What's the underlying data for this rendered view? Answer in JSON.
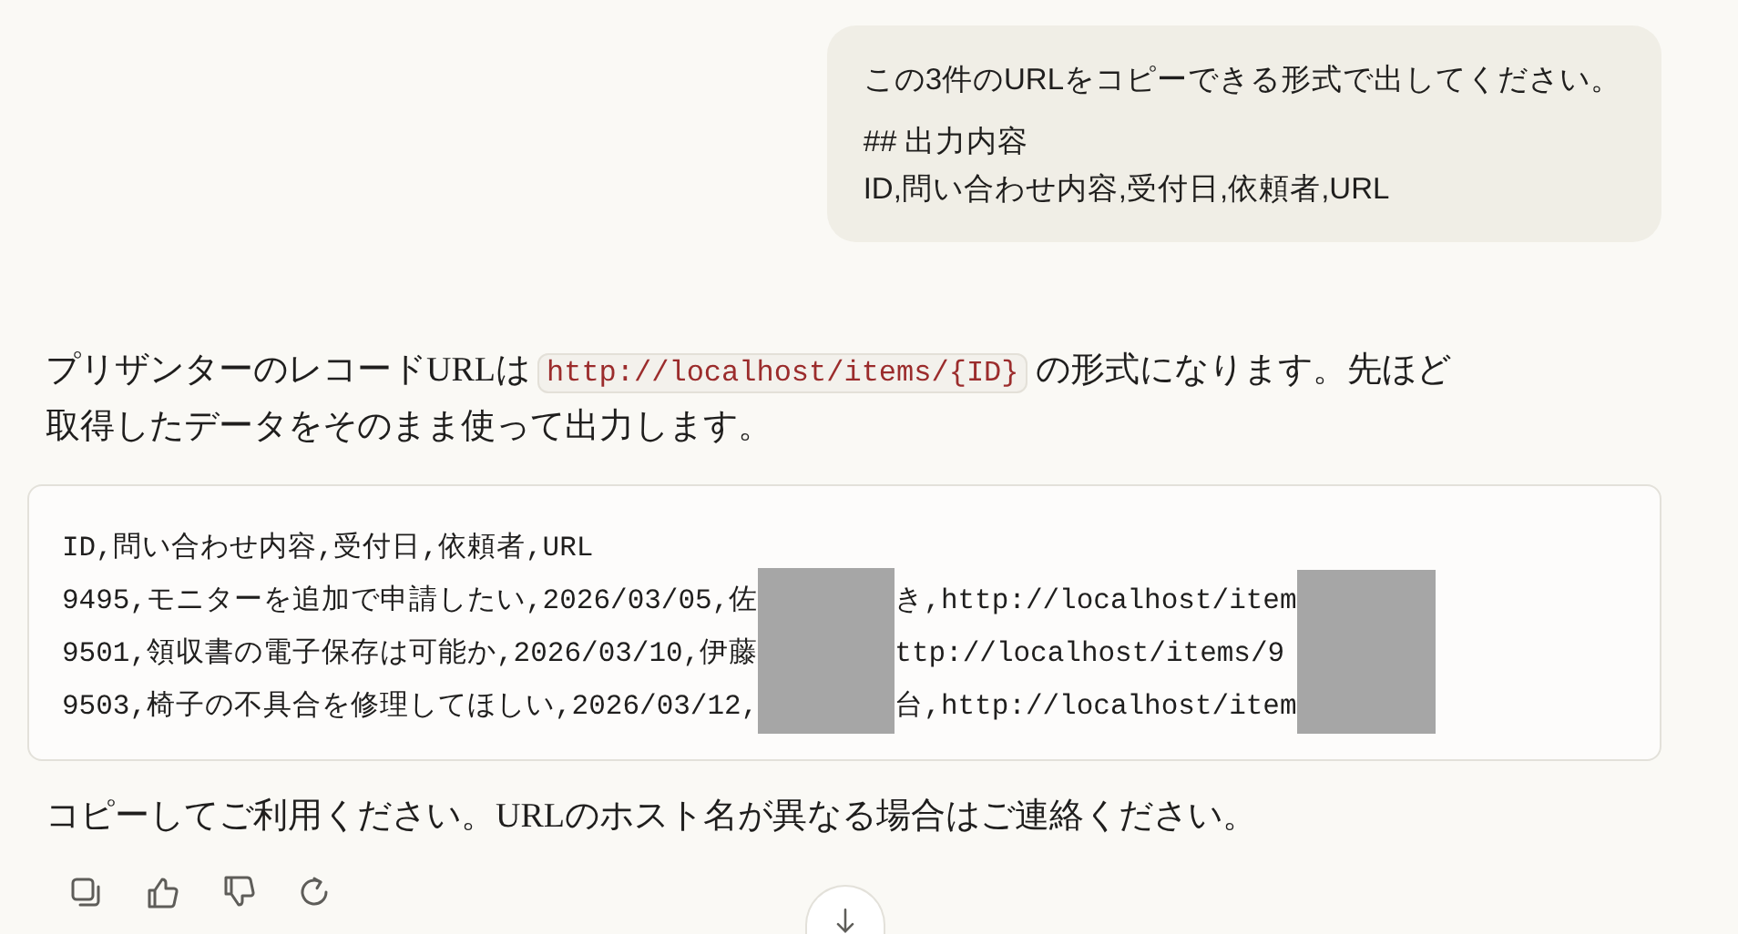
{
  "user_message": {
    "paragraphs": [
      [
        "この3件のURLをコピーできる形式で出してください。"
      ],
      [
        "## 出力内容",
        "ID,問い合わせ内容,受付日,依頼者,URL"
      ]
    ]
  },
  "assistant": {
    "intro": {
      "before": "プリザンターのレコードURLは",
      "code": "http://localhost/items/{ID}",
      "after": "の形式になります。先ほど取得したデータをそのまま使って出力します。"
    },
    "code_block": {
      "header": "ID,問い合わせ内容,受付日,依頼者,URL",
      "rows": [
        {
          "left": "9495,モニターを追加で申請したい,2026/03/05,佐",
          "middle": "き,http://localhost/item"
        },
        {
          "left": "9501,領収書の電子保存は可能か,2026/03/10,伊藤",
          "middle": "ttp://localhost/items/9"
        },
        {
          "left": "9503,椅子の不具合を修理してほしい,2026/03/12,",
          "middle": "台,http://localhost/item"
        }
      ]
    },
    "closing": "コピーしてご利用ください。URLのホスト名が異なる場合はご連絡ください。",
    "actions": [
      {
        "kind": "copy"
      },
      {
        "kind": "thumbs_up"
      },
      {
        "kind": "thumbs_down"
      },
      {
        "kind": "retry"
      }
    ]
  },
  "scroll_button": {
    "kind": "down"
  }
}
